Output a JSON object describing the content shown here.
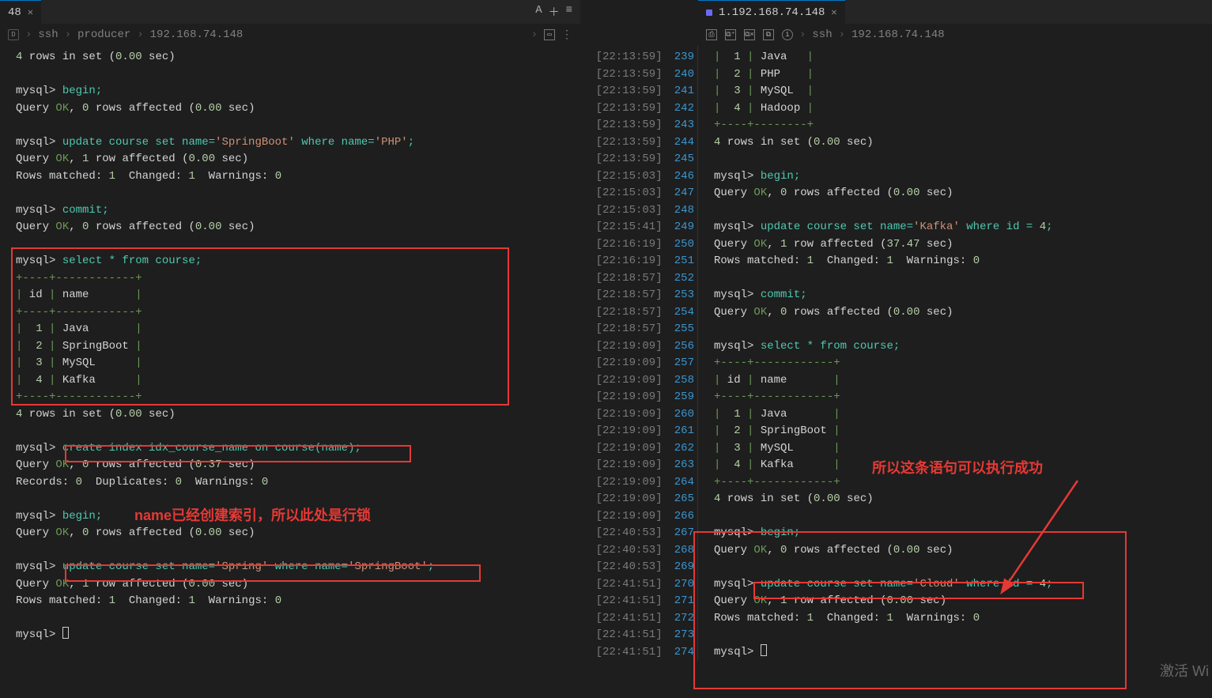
{
  "leftTab": {
    "title": "48",
    "host": "192.168.74.148"
  },
  "leftBreadcrumb": [
    "ssh",
    "producer",
    "192.168.74.148"
  ],
  "rightTab": {
    "title": "1.192.168.74.148"
  },
  "rightBreadcrumb": [
    "ssh",
    "192.168.74.148"
  ],
  "watermark": "激活 Wi",
  "annotations": {
    "leftNote": "name已经创建索引，所以此处是行锁",
    "rightNote": "所以这条语句可以执行成功"
  },
  "midLines": [
    {
      "t": "22:13:59",
      "n": 239
    },
    {
      "t": "22:13:59",
      "n": 240
    },
    {
      "t": "22:13:59",
      "n": 241
    },
    {
      "t": "22:13:59",
      "n": 242
    },
    {
      "t": "22:13:59",
      "n": 243
    },
    {
      "t": "22:13:59",
      "n": 244
    },
    {
      "t": "22:13:59",
      "n": 245
    },
    {
      "t": "22:15:03",
      "n": 246
    },
    {
      "t": "22:15:03",
      "n": 247
    },
    {
      "t": "22:15:03",
      "n": 248
    },
    {
      "t": "22:15:41",
      "n": 249
    },
    {
      "t": "22:16:19",
      "n": 250
    },
    {
      "t": "22:16:19",
      "n": 251
    },
    {
      "t": "22:18:57",
      "n": 252
    },
    {
      "t": "22:18:57",
      "n": 253
    },
    {
      "t": "22:18:57",
      "n": 254
    },
    {
      "t": "22:18:57",
      "n": 255
    },
    {
      "t": "22:19:09",
      "n": 256
    },
    {
      "t": "22:19:09",
      "n": 257
    },
    {
      "t": "22:19:09",
      "n": 258
    },
    {
      "t": "22:19:09",
      "n": 259
    },
    {
      "t": "22:19:09",
      "n": 260
    },
    {
      "t": "22:19:09",
      "n": 261
    },
    {
      "t": "22:19:09",
      "n": 262
    },
    {
      "t": "22:19:09",
      "n": 263
    },
    {
      "t": "22:19:09",
      "n": 264
    },
    {
      "t": "22:19:09",
      "n": 265
    },
    {
      "t": "22:19:09",
      "n": 266
    },
    {
      "t": "22:40:53",
      "n": 267
    },
    {
      "t": "22:40:53",
      "n": 268
    },
    {
      "t": "22:40:53",
      "n": 269
    },
    {
      "t": "22:41:51",
      "n": 270
    },
    {
      "t": "22:41:51",
      "n": 271
    },
    {
      "t": "22:41:51",
      "n": 272
    },
    {
      "t": "22:41:51",
      "n": 273
    },
    {
      "t": "22:41:51",
      "n": 274
    }
  ],
  "leftTerm": [
    [
      {
        "c": "c-num",
        "t": "4"
      },
      {
        "c": "c-white",
        "t": " rows in set ("
      },
      {
        "c": "c-num",
        "t": "0.00"
      },
      {
        "c": "c-white",
        "t": " sec)"
      }
    ],
    [],
    [
      {
        "c": "prompt",
        "t": "mysql> "
      },
      {
        "c": "c-cyan",
        "t": "begin;"
      }
    ],
    [
      {
        "c": "c-white",
        "t": "Query "
      },
      {
        "c": "c-green",
        "t": "OK"
      },
      {
        "c": "c-white",
        "t": ", "
      },
      {
        "c": "c-num",
        "t": "0"
      },
      {
        "c": "c-white",
        "t": " rows affected ("
      },
      {
        "c": "c-num",
        "t": "0.00"
      },
      {
        "c": "c-white",
        "t": " sec)"
      }
    ],
    [],
    [
      {
        "c": "prompt",
        "t": "mysql> "
      },
      {
        "c": "c-cyan",
        "t": "update course set name="
      },
      {
        "c": "str",
        "t": "'SpringBoot'"
      },
      {
        "c": "c-cyan",
        "t": " where name="
      },
      {
        "c": "str",
        "t": "'PHP'"
      },
      {
        "c": "c-cyan",
        "t": ";"
      }
    ],
    [
      {
        "c": "c-white",
        "t": "Query "
      },
      {
        "c": "c-green",
        "t": "OK"
      },
      {
        "c": "c-white",
        "t": ", "
      },
      {
        "c": "c-num",
        "t": "1"
      },
      {
        "c": "c-white",
        "t": " row affected ("
      },
      {
        "c": "c-num",
        "t": "0.00"
      },
      {
        "c": "c-white",
        "t": " sec)"
      }
    ],
    [
      {
        "c": "c-white",
        "t": "Rows matched: "
      },
      {
        "c": "c-num",
        "t": "1"
      },
      {
        "c": "c-white",
        "t": "  Changed: "
      },
      {
        "c": "c-num",
        "t": "1"
      },
      {
        "c": "c-white",
        "t": "  Warnings: "
      },
      {
        "c": "c-num",
        "t": "0"
      }
    ],
    [],
    [
      {
        "c": "prompt",
        "t": "mysql> "
      },
      {
        "c": "c-cyan",
        "t": "commit;"
      }
    ],
    [
      {
        "c": "c-white",
        "t": "Query "
      },
      {
        "c": "c-green",
        "t": "OK"
      },
      {
        "c": "c-white",
        "t": ", "
      },
      {
        "c": "c-num",
        "t": "0"
      },
      {
        "c": "c-white",
        "t": " rows affected ("
      },
      {
        "c": "c-num",
        "t": "0.00"
      },
      {
        "c": "c-white",
        "t": " sec)"
      }
    ],
    [],
    [
      {
        "c": "prompt",
        "t": "mysql> "
      },
      {
        "c": "c-cyan",
        "t": "select * from course;"
      }
    ],
    [
      {
        "c": "c-green",
        "t": "+----+------------+"
      }
    ],
    [
      {
        "c": "c-green",
        "t": "|"
      },
      {
        "c": "c-white",
        "t": " id "
      },
      {
        "c": "c-green",
        "t": "|"
      },
      {
        "c": "c-white",
        "t": " name       "
      },
      {
        "c": "c-green",
        "t": "|"
      }
    ],
    [
      {
        "c": "c-green",
        "t": "+----+------------+"
      }
    ],
    [
      {
        "c": "c-green",
        "t": "|"
      },
      {
        "c": "c-num",
        "t": "  1 "
      },
      {
        "c": "c-green",
        "t": "|"
      },
      {
        "c": "c-white",
        "t": " Java       "
      },
      {
        "c": "c-green",
        "t": "|"
      }
    ],
    [
      {
        "c": "c-green",
        "t": "|"
      },
      {
        "c": "c-num",
        "t": "  2 "
      },
      {
        "c": "c-green",
        "t": "|"
      },
      {
        "c": "c-white",
        "t": " SpringBoot "
      },
      {
        "c": "c-green",
        "t": "|"
      }
    ],
    [
      {
        "c": "c-green",
        "t": "|"
      },
      {
        "c": "c-num",
        "t": "  3 "
      },
      {
        "c": "c-green",
        "t": "|"
      },
      {
        "c": "c-white",
        "t": " MySQL      "
      },
      {
        "c": "c-green",
        "t": "|"
      }
    ],
    [
      {
        "c": "c-green",
        "t": "|"
      },
      {
        "c": "c-num",
        "t": "  4 "
      },
      {
        "c": "c-green",
        "t": "|"
      },
      {
        "c": "c-white",
        "t": " Kafka      "
      },
      {
        "c": "c-green",
        "t": "|"
      }
    ],
    [
      {
        "c": "c-green",
        "t": "+----+------------+"
      }
    ],
    [
      {
        "c": "c-num",
        "t": "4"
      },
      {
        "c": "c-white",
        "t": " rows in set ("
      },
      {
        "c": "c-num",
        "t": "0.00"
      },
      {
        "c": "c-white",
        "t": " sec)"
      }
    ],
    [],
    [
      {
        "c": "prompt",
        "t": "mysql> "
      },
      {
        "c": "c-cyan",
        "t": "create index idx_course_name on course(name);"
      }
    ],
    [
      {
        "c": "c-white",
        "t": "Query "
      },
      {
        "c": "c-green",
        "t": "OK"
      },
      {
        "c": "c-white",
        "t": ", "
      },
      {
        "c": "c-num",
        "t": "0"
      },
      {
        "c": "c-white",
        "t": " rows affected ("
      },
      {
        "c": "c-num",
        "t": "0.37"
      },
      {
        "c": "c-white",
        "t": " sec)"
      }
    ],
    [
      {
        "c": "c-white",
        "t": "Records: "
      },
      {
        "c": "c-num",
        "t": "0"
      },
      {
        "c": "c-white",
        "t": "  Duplicates: "
      },
      {
        "c": "c-num",
        "t": "0"
      },
      {
        "c": "c-white",
        "t": "  Warnings: "
      },
      {
        "c": "c-num",
        "t": "0"
      }
    ],
    [],
    [
      {
        "c": "prompt",
        "t": "mysql> "
      },
      {
        "c": "c-cyan",
        "t": "begin;"
      }
    ],
    [
      {
        "c": "c-white",
        "t": "Query "
      },
      {
        "c": "c-green",
        "t": "OK"
      },
      {
        "c": "c-white",
        "t": ", "
      },
      {
        "c": "c-num",
        "t": "0"
      },
      {
        "c": "c-white",
        "t": " rows affected ("
      },
      {
        "c": "c-num",
        "t": "0.00"
      },
      {
        "c": "c-white",
        "t": " sec)"
      }
    ],
    [],
    [
      {
        "c": "prompt",
        "t": "mysql> "
      },
      {
        "c": "c-cyan",
        "t": "update course set name="
      },
      {
        "c": "str",
        "t": "'Spring'"
      },
      {
        "c": "c-cyan",
        "t": " where name="
      },
      {
        "c": "str",
        "t": "'SpringBoot'"
      },
      {
        "c": "c-cyan",
        "t": ";"
      }
    ],
    [
      {
        "c": "c-white",
        "t": "Query "
      },
      {
        "c": "c-green",
        "t": "OK"
      },
      {
        "c": "c-white",
        "t": ", "
      },
      {
        "c": "c-num",
        "t": "1"
      },
      {
        "c": "c-white",
        "t": " row affected ("
      },
      {
        "c": "c-num",
        "t": "0.00"
      },
      {
        "c": "c-white",
        "t": " sec)"
      }
    ],
    [
      {
        "c": "c-white",
        "t": "Rows matched: "
      },
      {
        "c": "c-num",
        "t": "1"
      },
      {
        "c": "c-white",
        "t": "  Changed: "
      },
      {
        "c": "c-num",
        "t": "1"
      },
      {
        "c": "c-white",
        "t": "  Warnings: "
      },
      {
        "c": "c-num",
        "t": "0"
      }
    ],
    [],
    [
      {
        "c": "prompt",
        "t": "mysql> "
      },
      {
        "cursor": true
      }
    ]
  ],
  "rightTerm": [
    [
      {
        "c": "c-green",
        "t": "|"
      },
      {
        "c": "c-num",
        "t": "  1 "
      },
      {
        "c": "c-green",
        "t": "|"
      },
      {
        "c": "c-white",
        "t": " Java   "
      },
      {
        "c": "c-green",
        "t": "|"
      }
    ],
    [
      {
        "c": "c-green",
        "t": "|"
      },
      {
        "c": "c-num",
        "t": "  2 "
      },
      {
        "c": "c-green",
        "t": "|"
      },
      {
        "c": "c-white",
        "t": " PHP    "
      },
      {
        "c": "c-green",
        "t": "|"
      }
    ],
    [
      {
        "c": "c-green",
        "t": "|"
      },
      {
        "c": "c-num",
        "t": "  3 "
      },
      {
        "c": "c-green",
        "t": "|"
      },
      {
        "c": "c-white",
        "t": " MySQL  "
      },
      {
        "c": "c-green",
        "t": "|"
      }
    ],
    [
      {
        "c": "c-green",
        "t": "|"
      },
      {
        "c": "c-num",
        "t": "  4 "
      },
      {
        "c": "c-green",
        "t": "|"
      },
      {
        "c": "c-white",
        "t": " Hadoop "
      },
      {
        "c": "c-green",
        "t": "|"
      }
    ],
    [
      {
        "c": "c-green",
        "t": "+----+--------+"
      }
    ],
    [
      {
        "c": "c-num",
        "t": "4"
      },
      {
        "c": "c-white",
        "t": " rows in set ("
      },
      {
        "c": "c-num",
        "t": "0.00"
      },
      {
        "c": "c-white",
        "t": " sec)"
      }
    ],
    [],
    [
      {
        "c": "prompt",
        "t": "mysql> "
      },
      {
        "c": "c-cyan",
        "t": "begin;"
      }
    ],
    [
      {
        "c": "c-white",
        "t": "Query "
      },
      {
        "c": "c-green",
        "t": "OK"
      },
      {
        "c": "c-white",
        "t": ", "
      },
      {
        "c": "c-num",
        "t": "0"
      },
      {
        "c": "c-white",
        "t": " rows affected ("
      },
      {
        "c": "c-num",
        "t": "0.00"
      },
      {
        "c": "c-white",
        "t": " sec)"
      }
    ],
    [],
    [
      {
        "c": "prompt",
        "t": "mysql> "
      },
      {
        "c": "c-cyan",
        "t": "update course set name="
      },
      {
        "c": "str",
        "t": "'Kafka'"
      },
      {
        "c": "c-cyan",
        "t": " where id = "
      },
      {
        "c": "c-num",
        "t": "4"
      },
      {
        "c": "c-cyan",
        "t": ";"
      }
    ],
    [
      {
        "c": "c-white",
        "t": "Query "
      },
      {
        "c": "c-green",
        "t": "OK"
      },
      {
        "c": "c-white",
        "t": ", "
      },
      {
        "c": "c-num",
        "t": "1"
      },
      {
        "c": "c-white",
        "t": " row affected ("
      },
      {
        "c": "c-num",
        "t": "37.47"
      },
      {
        "c": "c-white",
        "t": " sec)"
      }
    ],
    [
      {
        "c": "c-white",
        "t": "Rows matched: "
      },
      {
        "c": "c-num",
        "t": "1"
      },
      {
        "c": "c-white",
        "t": "  Changed: "
      },
      {
        "c": "c-num",
        "t": "1"
      },
      {
        "c": "c-white",
        "t": "  Warnings: "
      },
      {
        "c": "c-num",
        "t": "0"
      }
    ],
    [],
    [
      {
        "c": "prompt",
        "t": "mysql> "
      },
      {
        "c": "c-cyan",
        "t": "commit;"
      }
    ],
    [
      {
        "c": "c-white",
        "t": "Query "
      },
      {
        "c": "c-green",
        "t": "OK"
      },
      {
        "c": "c-white",
        "t": ", "
      },
      {
        "c": "c-num",
        "t": "0"
      },
      {
        "c": "c-white",
        "t": " rows affected ("
      },
      {
        "c": "c-num",
        "t": "0.00"
      },
      {
        "c": "c-white",
        "t": " sec)"
      }
    ],
    [],
    [
      {
        "c": "prompt",
        "t": "mysql> "
      },
      {
        "c": "c-cyan",
        "t": "select * from course;"
      }
    ],
    [
      {
        "c": "c-green",
        "t": "+----+------------+"
      }
    ],
    [
      {
        "c": "c-green",
        "t": "|"
      },
      {
        "c": "c-white",
        "t": " id "
      },
      {
        "c": "c-green",
        "t": "|"
      },
      {
        "c": "c-white",
        "t": " name       "
      },
      {
        "c": "c-green",
        "t": "|"
      }
    ],
    [
      {
        "c": "c-green",
        "t": "+----+------------+"
      }
    ],
    [
      {
        "c": "c-green",
        "t": "|"
      },
      {
        "c": "c-num",
        "t": "  1 "
      },
      {
        "c": "c-green",
        "t": "|"
      },
      {
        "c": "c-white",
        "t": " Java       "
      },
      {
        "c": "c-green",
        "t": "|"
      }
    ],
    [
      {
        "c": "c-green",
        "t": "|"
      },
      {
        "c": "c-num",
        "t": "  2 "
      },
      {
        "c": "c-green",
        "t": "|"
      },
      {
        "c": "c-white",
        "t": " SpringBoot "
      },
      {
        "c": "c-green",
        "t": "|"
      }
    ],
    [
      {
        "c": "c-green",
        "t": "|"
      },
      {
        "c": "c-num",
        "t": "  3 "
      },
      {
        "c": "c-green",
        "t": "|"
      },
      {
        "c": "c-white",
        "t": " MySQL      "
      },
      {
        "c": "c-green",
        "t": "|"
      }
    ],
    [
      {
        "c": "c-green",
        "t": "|"
      },
      {
        "c": "c-num",
        "t": "  4 "
      },
      {
        "c": "c-green",
        "t": "|"
      },
      {
        "c": "c-white",
        "t": " Kafka      "
      },
      {
        "c": "c-green",
        "t": "|"
      }
    ],
    [
      {
        "c": "c-green",
        "t": "+----+------------+"
      }
    ],
    [
      {
        "c": "c-num",
        "t": "4"
      },
      {
        "c": "c-white",
        "t": " rows in set ("
      },
      {
        "c": "c-num",
        "t": "0.00"
      },
      {
        "c": "c-white",
        "t": " sec)"
      }
    ],
    [],
    [
      {
        "c": "prompt",
        "t": "mysql> "
      },
      {
        "c": "c-cyan",
        "t": "begin;"
      }
    ],
    [
      {
        "c": "c-white",
        "t": "Query "
      },
      {
        "c": "c-green",
        "t": "OK"
      },
      {
        "c": "c-white",
        "t": ", "
      },
      {
        "c": "c-num",
        "t": "0"
      },
      {
        "c": "c-white",
        "t": " rows affected ("
      },
      {
        "c": "c-num",
        "t": "0.00"
      },
      {
        "c": "c-white",
        "t": " sec)"
      }
    ],
    [],
    [
      {
        "c": "prompt",
        "t": "mysql> "
      },
      {
        "c": "c-cyan",
        "t": "update course set name="
      },
      {
        "c": "str",
        "t": "'Cloud'"
      },
      {
        "c": "c-cyan",
        "t": " where id = "
      },
      {
        "c": "c-num",
        "t": "4"
      },
      {
        "c": "c-cyan",
        "t": ";"
      }
    ],
    [
      {
        "c": "c-white",
        "t": "Query "
      },
      {
        "c": "c-green",
        "t": "OK"
      },
      {
        "c": "c-white",
        "t": ", "
      },
      {
        "c": "c-num",
        "t": "1"
      },
      {
        "c": "c-white",
        "t": " row affected ("
      },
      {
        "c": "c-num",
        "t": "0.00"
      },
      {
        "c": "c-white",
        "t": " sec)"
      }
    ],
    [
      {
        "c": "c-white",
        "t": "Rows matched: "
      },
      {
        "c": "c-num",
        "t": "1"
      },
      {
        "c": "c-white",
        "t": "  Changed: "
      },
      {
        "c": "c-num",
        "t": "1"
      },
      {
        "c": "c-white",
        "t": "  Warnings: "
      },
      {
        "c": "c-num",
        "t": "0"
      }
    ],
    [],
    [
      {
        "c": "prompt",
        "t": "mysql> "
      },
      {
        "cursor": true
      }
    ]
  ]
}
